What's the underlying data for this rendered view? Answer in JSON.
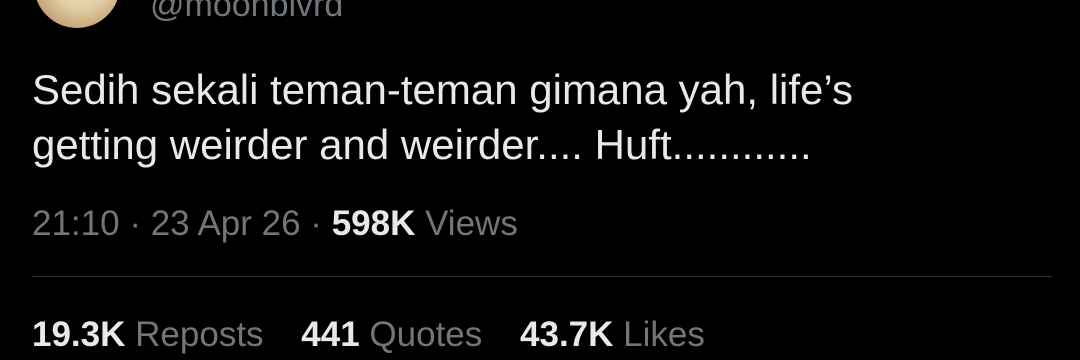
{
  "author": {
    "handle": "@moonblvrd"
  },
  "tweet": {
    "text_line1": "Sedih sekali teman-teman gimana yah, life’s",
    "text_line2": "getting weirder and weirder.... Huft............"
  },
  "meta": {
    "time": "21:10",
    "separator": "·",
    "date": "23 Apr 26",
    "views_count": "598K",
    "views_label": "Views"
  },
  "stats": [
    {
      "count": "19.3K",
      "label": "Reposts"
    },
    {
      "count": "441",
      "label": "Quotes"
    },
    {
      "count": "43.7K",
      "label": "Likes"
    }
  ],
  "colors": {
    "background": "#000000",
    "text_primary": "#e7e9ea",
    "text_secondary": "#71767b",
    "divider": "#2f3336"
  }
}
